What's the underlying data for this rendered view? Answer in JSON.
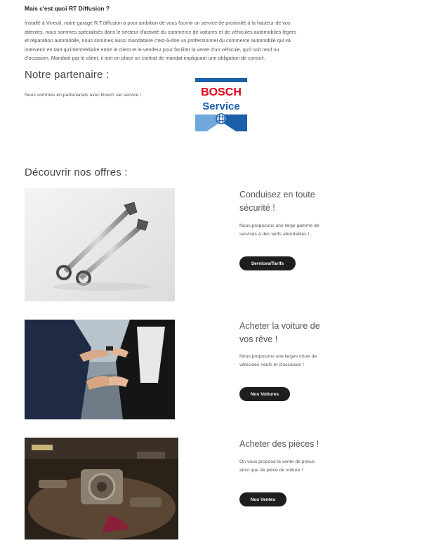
{
  "intro": {
    "title": "Mais c'est quoi RT Diffusion ?",
    "lines": [
      "Installé à Vineuil, notre garage R.T.diffusion a pour ambition de vous fournir un service de proximité à la hauteur de vos",
      "attentes, nous sommes spécialisés dans le secteur d'activité du commerce de voitures et de véhicules automobiles légers",
      "et réparation automobile, nous sommes aussi mandataire c'est-à-dire un professionnel du commerce automobile qui va",
      "intervenir en tant qu'intermédiaire entre le client et le vendeur pour faciliter la vente d'un véhicule, qu'il soit neuf ou",
      "d'occasion. Mandaté par le client, il met en place un contrat de mandat impliquant une obligation de conseil."
    ]
  },
  "partner": {
    "heading": "Notre partenaire :",
    "text": "Nous sommes en partenariats avec Bosch car service !",
    "logo": {
      "line1": "BOSCH",
      "line2": "Service",
      "colors": {
        "red": "#e2001a",
        "blue": "#1b5fa8",
        "light_blue": "#6fa8dc"
      }
    }
  },
  "offers": {
    "heading": "Découvrir nos offres :",
    "items": [
      {
        "title_lines": [
          "Conduisez en toute",
          "sécurité !"
        ],
        "desc_lines": [
          "Nous proposons une large gamme de",
          "services à des tarifs abordables !"
        ],
        "button": "Services/Tarifs",
        "image": "wrenches-photo"
      },
      {
        "title_lines": [
          "Acheter la voiture de",
          "vos rêve !"
        ],
        "desc_lines": [
          "Nous proposons une larges choix de",
          "véhicules neufs et d'occasion !"
        ],
        "button": "Nos Voitures",
        "image": "car-sale-handshake-photo"
      },
      {
        "title_lines": [
          "Acheter des pièces !"
        ],
        "desc_lines": [
          "On vous propose la vente de pneus",
          "ainsi que de pièce de voiture !"
        ],
        "button": "Nos Ventes",
        "image": "car-parts-workshop-photo"
      }
    ]
  }
}
